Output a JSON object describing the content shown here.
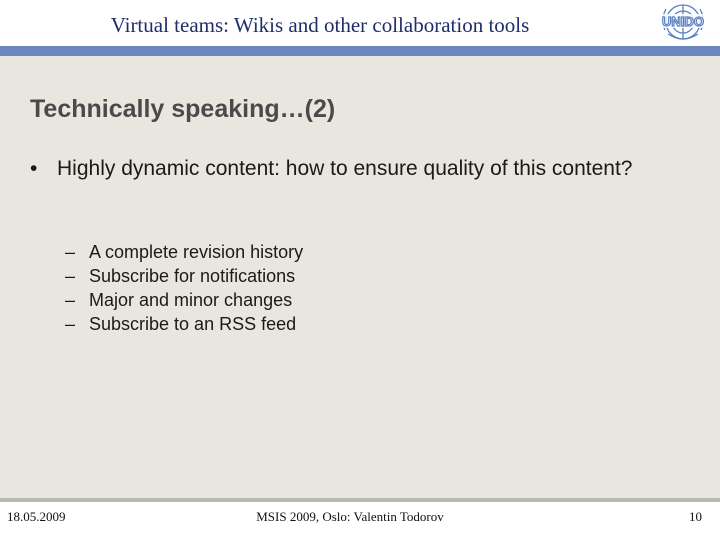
{
  "header": {
    "title": "Virtual teams: Wikis and other collaboration tools",
    "logo_text": "UNIDO",
    "logo_icon": "un-emblem-icon"
  },
  "slide": {
    "title": "Technically speaking…(2)",
    "bullet": {
      "symbol": "•",
      "text": "Highly dynamic content: how to ensure quality of this content?"
    },
    "sub_items": [
      {
        "dash": "–",
        "text": "A complete revision history"
      },
      {
        "dash": "–",
        "text": "Subscribe for notifications"
      },
      {
        "dash": "–",
        "text": "Major and minor changes"
      },
      {
        "dash": "–",
        "text": "Subscribe to an RSS feed"
      }
    ]
  },
  "footer": {
    "date": "18.05.2009",
    "center": "MSIS 2009, Oslo: Valentin Todorov",
    "page": "10"
  },
  "colors": {
    "header_title": "#1f2d6b",
    "blue_bar": "#6b86bf",
    "content_bg": "#e8e6df",
    "slide_title": "#4a4a4a",
    "logo": "#5a7fc0"
  }
}
